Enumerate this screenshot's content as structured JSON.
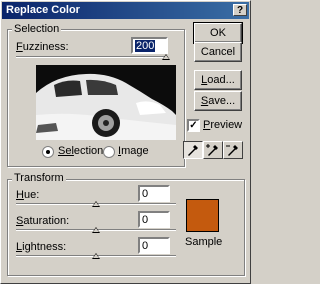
{
  "window": {
    "title": "Replace Color",
    "help": "?"
  },
  "selection": {
    "group_label": "Selection",
    "fuzziness_label_u": "F",
    "fuzziness_label_rest": "uzziness:",
    "fuzziness_value": "200",
    "fuzziness_level": 1.0,
    "radio_selection_u": "Sel",
    "radio_selection_rest": "ection",
    "radio_image_u": "I",
    "radio_image_rest": "mage",
    "selected_mode": "selection"
  },
  "buttons": {
    "ok": "OK",
    "cancel": "Cancel",
    "load_u": "L",
    "load_rest": "oad...",
    "save_u": "S",
    "save_rest": "ave..."
  },
  "preview_checkbox": {
    "label_u": "P",
    "label_rest": "review",
    "checked": true
  },
  "transform": {
    "group_label": "Transform",
    "hue": {
      "label_u": "H",
      "label_rest": "ue:",
      "value": "0",
      "level": 0.5
    },
    "saturation": {
      "label_u": "S",
      "label_rest": "aturation:",
      "value": "0",
      "level": 0.5
    },
    "lightness": {
      "label_u": "L",
      "label_rest": "ightness:",
      "value": "0",
      "level": 0.5
    },
    "sample_label": "Sample",
    "sample_color": "#c45a0e"
  },
  "icons": [
    "eyedropper-icon",
    "eyedropper-plus-icon",
    "eyedropper-minus-icon"
  ]
}
